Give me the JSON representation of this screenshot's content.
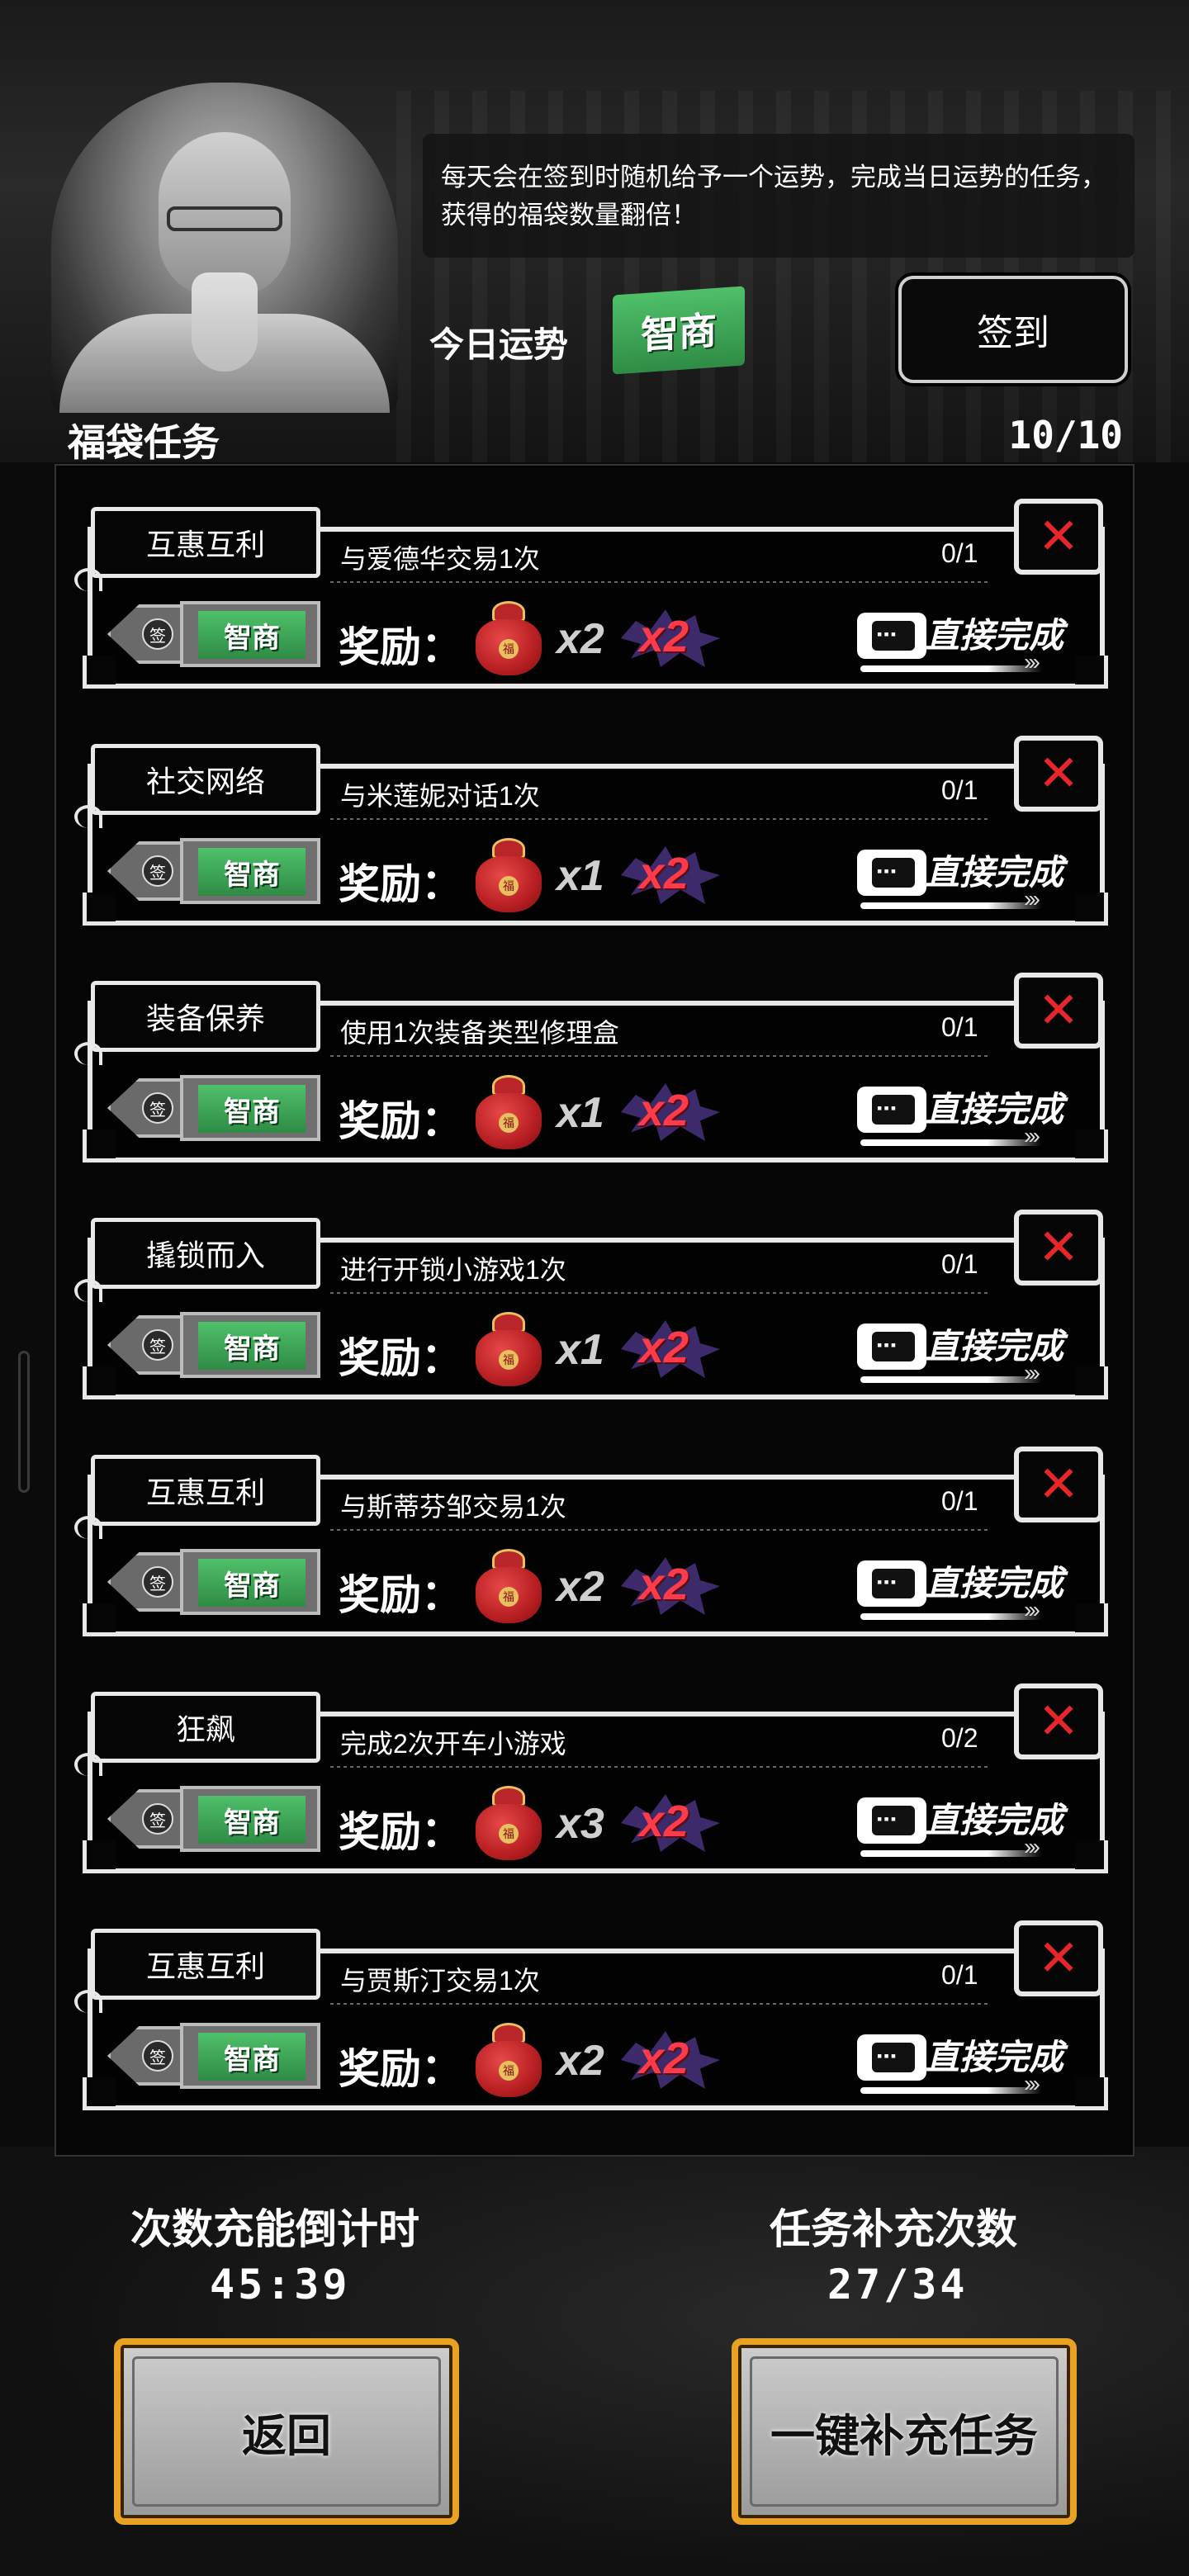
{
  "header": {
    "tip": "每天会在签到时随机给予一个运势，完成当日运势的任务，获得的福袋数量翻倍！",
    "fortune_label": "今日运势",
    "fortune_value": "智商",
    "signin_label": "签到"
  },
  "section": {
    "title": "福袋任务",
    "count": "10/10"
  },
  "tasks": [
    {
      "name": "互惠互利",
      "desc": "与爱德华交易1次",
      "progress": "0/1",
      "sign": "签",
      "badge": "智商",
      "reward_label": "奖励：",
      "qty": "x2",
      "mult": "x2",
      "direct": "直接完成"
    },
    {
      "name": "社交网络",
      "desc": "与米莲妮对话1次",
      "progress": "0/1",
      "sign": "签",
      "badge": "智商",
      "reward_label": "奖励：",
      "qty": "x1",
      "mult": "x2",
      "direct": "直接完成"
    },
    {
      "name": "装备保养",
      "desc": "使用1次装备类型修理盒",
      "progress": "0/1",
      "sign": "签",
      "badge": "智商",
      "reward_label": "奖励：",
      "qty": "x1",
      "mult": "x2",
      "direct": "直接完成"
    },
    {
      "name": "撬锁而入",
      "desc": "进行开锁小游戏1次",
      "progress": "0/1",
      "sign": "签",
      "badge": "智商",
      "reward_label": "奖励：",
      "qty": "x1",
      "mult": "x2",
      "direct": "直接完成"
    },
    {
      "name": "互惠互利",
      "desc": "与斯蒂芬邹交易1次",
      "progress": "0/1",
      "sign": "签",
      "badge": "智商",
      "reward_label": "奖励：",
      "qty": "x2",
      "mult": "x2",
      "direct": "直接完成"
    },
    {
      "name": "狂飙",
      "desc": "完成2次开车小游戏",
      "progress": "0/2",
      "sign": "签",
      "badge": "智商",
      "reward_label": "奖励：",
      "qty": "x3",
      "mult": "x2",
      "direct": "直接完成"
    },
    {
      "name": "互惠互利",
      "desc": "与贾斯汀交易1次",
      "progress": "0/1",
      "sign": "签",
      "badge": "智商",
      "reward_label": "奖励：",
      "qty": "x2",
      "mult": "x2",
      "direct": "直接完成"
    }
  ],
  "footer": {
    "countdown_label": "次数充能倒计时",
    "countdown_value": "45:39",
    "refill_label": "任务补充次数",
    "refill_value": "27/34",
    "back_label": "返回",
    "refill_all_label": "一键补充任务"
  },
  "colors": {
    "accent_green": "#3aa355",
    "close_red": "#e8262a",
    "mult_red": "#ff3b4a",
    "button_gold": "#e8a324"
  }
}
